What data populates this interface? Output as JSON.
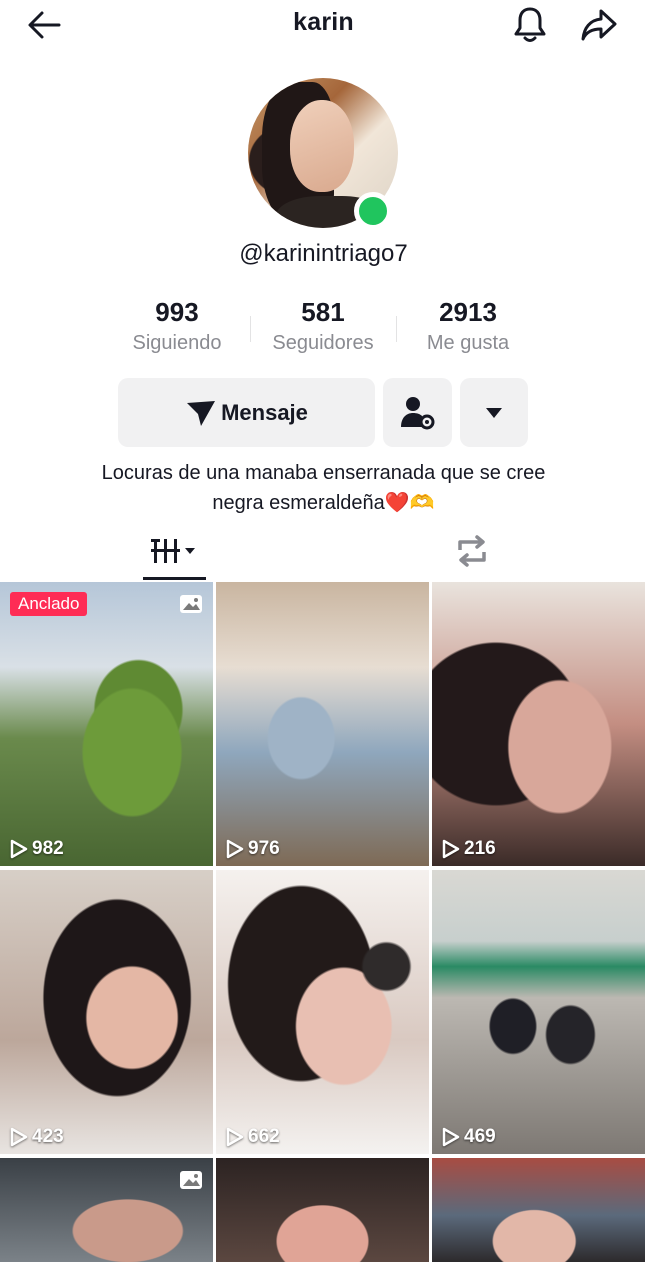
{
  "header": {
    "title": "karin",
    "back_icon": "arrow-left-icon",
    "bell_icon": "bell-icon",
    "share_icon": "share-icon"
  },
  "profile": {
    "handle": "@karinintriago7",
    "online_color": "#20c55e"
  },
  "stats": [
    {
      "value": "993",
      "label": "Siguiendo"
    },
    {
      "value": "581",
      "label": "Seguidores"
    },
    {
      "value": "2913",
      "label": "Me gusta"
    }
  ],
  "actions": {
    "message_label": "Mensaje",
    "follow_icon": "person-gear-icon",
    "more_icon": "caret-down-icon"
  },
  "bio": {
    "line1": "Locuras de una manaba enserranada que se cree",
    "line2": "negra esmeraldeña",
    "emoji_heart": "❤️",
    "emoji_hands": "🫶"
  },
  "tabs": {
    "videos_icon": "grid-bars-icon",
    "repost_icon": "repost-icon"
  },
  "colors": {
    "accent": "#fe2c55",
    "text": "#161823",
    "muted": "#8a8b91",
    "button_bg": "#f1f1f2"
  },
  "videos": [
    {
      "views": "982",
      "pinned_label": "Anclado",
      "photo": true
    },
    {
      "views": "976"
    },
    {
      "views": "216"
    },
    {
      "views": "423"
    },
    {
      "views": "662"
    },
    {
      "views": "469"
    },
    {
      "views": "",
      "photo": true
    },
    {
      "views": ""
    },
    {
      "views": ""
    }
  ]
}
